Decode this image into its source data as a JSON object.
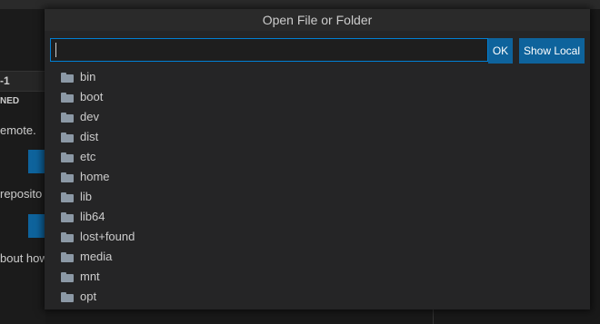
{
  "background": {
    "header_text": "-1",
    "section_label": "NED",
    "lines": [
      "emote.",
      " reposito",
      "bout how"
    ]
  },
  "dialog": {
    "title": "Open File or Folder",
    "input_value": "",
    "ok_label": "OK",
    "show_local_label": "Show Local"
  },
  "items": [
    {
      "label": "bin",
      "icon": "folder-icon"
    },
    {
      "label": "boot",
      "icon": "folder-icon"
    },
    {
      "label": "dev",
      "icon": "folder-icon"
    },
    {
      "label": "dist",
      "icon": "folder-icon"
    },
    {
      "label": "etc",
      "icon": "folder-icon"
    },
    {
      "label": "home",
      "icon": "folder-icon"
    },
    {
      "label": "lib",
      "icon": "folder-icon"
    },
    {
      "label": "lib64",
      "icon": "folder-icon"
    },
    {
      "label": "lost+found",
      "icon": "folder-icon"
    },
    {
      "label": "media",
      "icon": "folder-icon"
    },
    {
      "label": "mnt",
      "icon": "folder-icon"
    },
    {
      "label": "opt",
      "icon": "folder-icon"
    }
  ],
  "colors": {
    "accent": "#0e639c",
    "focus_border": "#007fd4",
    "dialog_bg": "#252526",
    "folder_icon": "#8c99a6"
  }
}
